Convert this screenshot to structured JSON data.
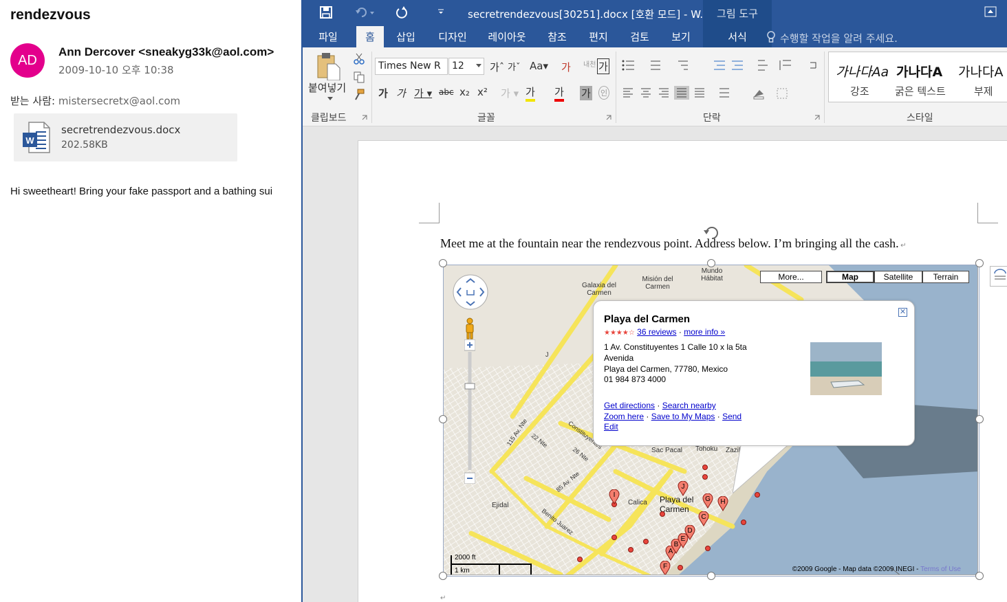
{
  "mail": {
    "subject": "rendezvous",
    "avatar_initials": "AD",
    "avatar_color": "#e3008c",
    "from": "Ann Dercover <sneakyg33k@aol.com>",
    "date": "2009-10-10 오후 10:38",
    "to_label": "받는 사람:",
    "to_address": "mistersecretx@aol.com",
    "attachment": {
      "name": "secretrendezvous.docx",
      "size": "202.58KB",
      "icon": "word-file-icon"
    },
    "body": "Hi sweetheart! Bring your fake passport and a bathing sui"
  },
  "word": {
    "accent_color": "#2b579a",
    "title": "secretrendezvous[30251].docx [호환 모드] - W...",
    "context_group": "그림 도구",
    "tabs": [
      "파일",
      "홈",
      "삽입",
      "디자인",
      "레이아웃",
      "참조",
      "편지",
      "검토",
      "보기",
      "서식"
    ],
    "active_tab": "홈",
    "tell_me": "수행할 작업을 알려 주세요.",
    "ribbon": {
      "paste_label": "붙여넣기",
      "clipboard_label": "클립보드",
      "font_label": "글꼴",
      "paragraph_label": "단락",
      "styles_label": "스타일",
      "font_name": "Times New R",
      "font_size": "12",
      "styles": [
        {
          "preview": "가나다Aa",
          "name": "강조"
        },
        {
          "preview": "가나다A",
          "name": "굵은 텍스트"
        },
        {
          "preview": "가나다A",
          "name": "부제"
        }
      ]
    },
    "document": {
      "text": "Meet me at the fountain near the rendezvous point. Address below. I’m bringing all the cash.",
      "map": {
        "buttons": {
          "more": "More...",
          "map": "Map",
          "satellite": "Satellite",
          "terrain": "Terrain"
        },
        "place": {
          "title": "Playa del Carmen",
          "rating_stars": 4,
          "reviews": "36 reviews",
          "more_info": "more info »",
          "address_1": "1 Av. Constituyentes 1 Calle 10 x la 5ta",
          "address_2": "Avenida",
          "address_3": "Playa del Carmen, 77780, Mexico",
          "phone": "01 984 873 4000",
          "links": {
            "directions": "Get directions",
            "nearby": "Search nearby",
            "zoom": "Zoom here",
            "save": "Save to My Maps",
            "send": "Send",
            "edit": "Edit"
          }
        },
        "labels": {
          "galaxia": "Galaxia del Carmen",
          "mision": "Misión del Carmen",
          "mundo": "Mundo Hábitat",
          "ejidal": "Ejidal",
          "calica": "Calica",
          "playa": "Playa del Carmen",
          "sac": "Sac Pacal",
          "tohoku": "Tohoku",
          "zazil": "Zazil-ha",
          "benito": "Benito Juarez",
          "av115": "115 Av. Nte",
          "nte22": "22 Nte",
          "nte26": "26 Nte",
          "av85": "85 Av. Nte",
          "constituyentes": "Constituyentes",
          "j": "J"
        },
        "scale": {
          "ft": "2000 ft",
          "km": "1 km"
        },
        "copyright": "©2009 Google - Map data ©2009 INEGI - ",
        "terms": "Terms of Use",
        "markers": [
          "A",
          "B",
          "C",
          "D",
          "E",
          "F",
          "G",
          "H",
          "I",
          "J"
        ]
      }
    }
  }
}
